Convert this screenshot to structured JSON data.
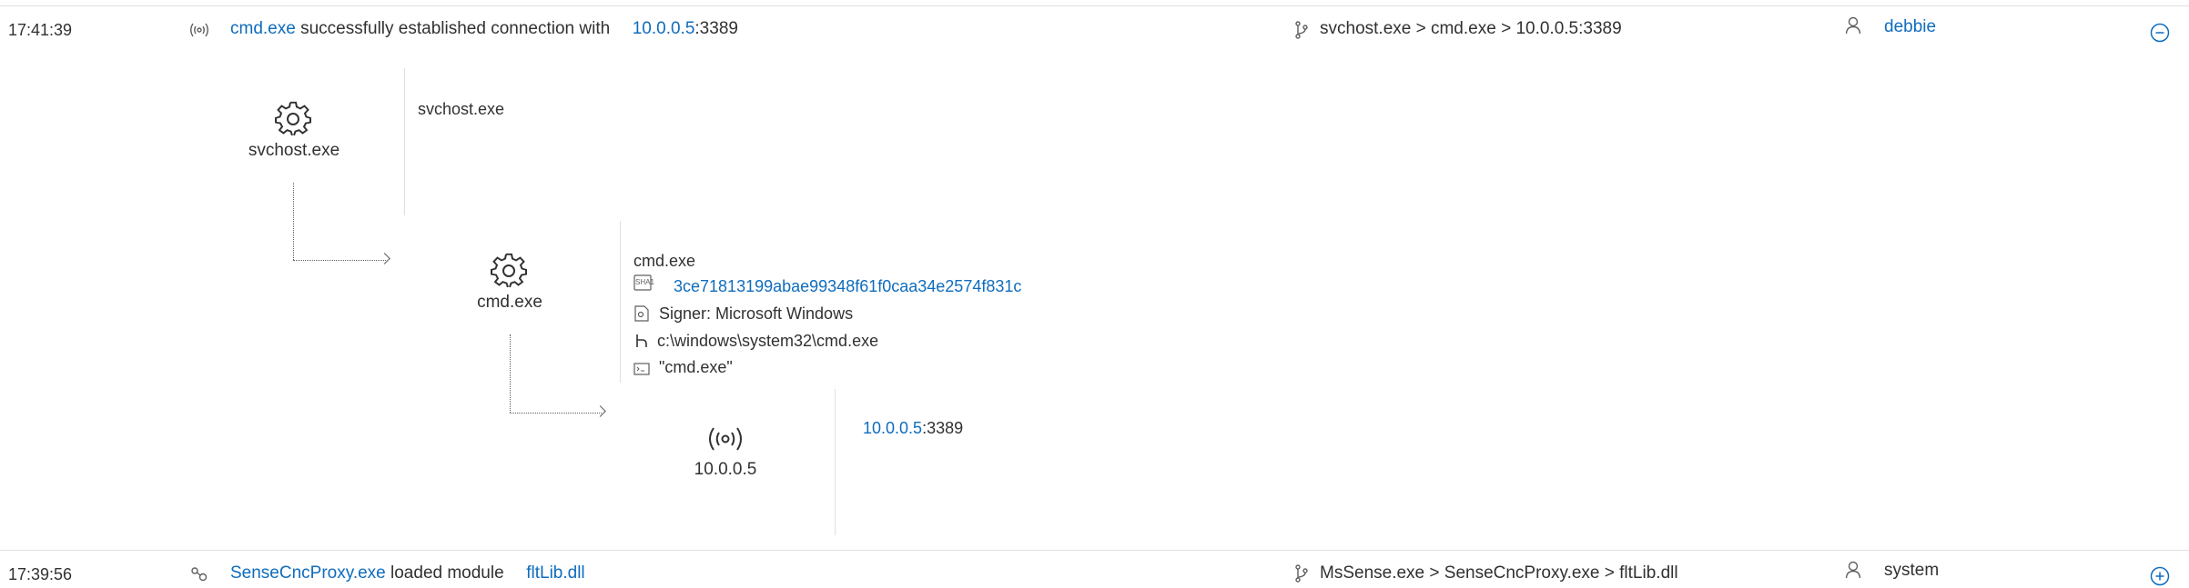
{
  "rows": [
    {
      "time": "17:41:39",
      "event_icon": "network-broadcast-icon",
      "process": "cmd.exe",
      "action": "successfully established connection with",
      "target_ip": "10.0.0.5",
      "target_port": ":3389",
      "tree_icon": "process-tree-icon",
      "path": "svchost.exe > cmd.exe > 10.0.0.5:3389",
      "user_icon": "user-icon",
      "user": "debbie",
      "toggle": "collapse"
    },
    {
      "time": "17:39:56",
      "event_icon": "module-load-icon",
      "process": "SenseCncProxy.exe",
      "action": "loaded module",
      "module": "fltLib.dll",
      "tree_icon": "process-tree-icon",
      "path": "MsSense.exe > SenseCncProxy.exe > fltLib.dll",
      "user_icon": "user-icon",
      "user": "system",
      "toggle": "expand"
    }
  ],
  "tree": {
    "parent": {
      "label": "svchost.exe",
      "detail_title": "svchost.exe"
    },
    "child": {
      "label": "cmd.exe",
      "detail_title": "cmd.exe",
      "hash_badge": "SHA1",
      "sha1": "3ce71813199abae99348f61f0caa34e2574f831c",
      "signer": "Signer: Microsoft Windows",
      "path": "c:\\windows\\system32\\cmd.exe",
      "command_line": "\"cmd.exe\""
    },
    "network": {
      "label": "10.0.0.5",
      "ip": "10.0.0.5",
      "port": ":3389"
    }
  }
}
